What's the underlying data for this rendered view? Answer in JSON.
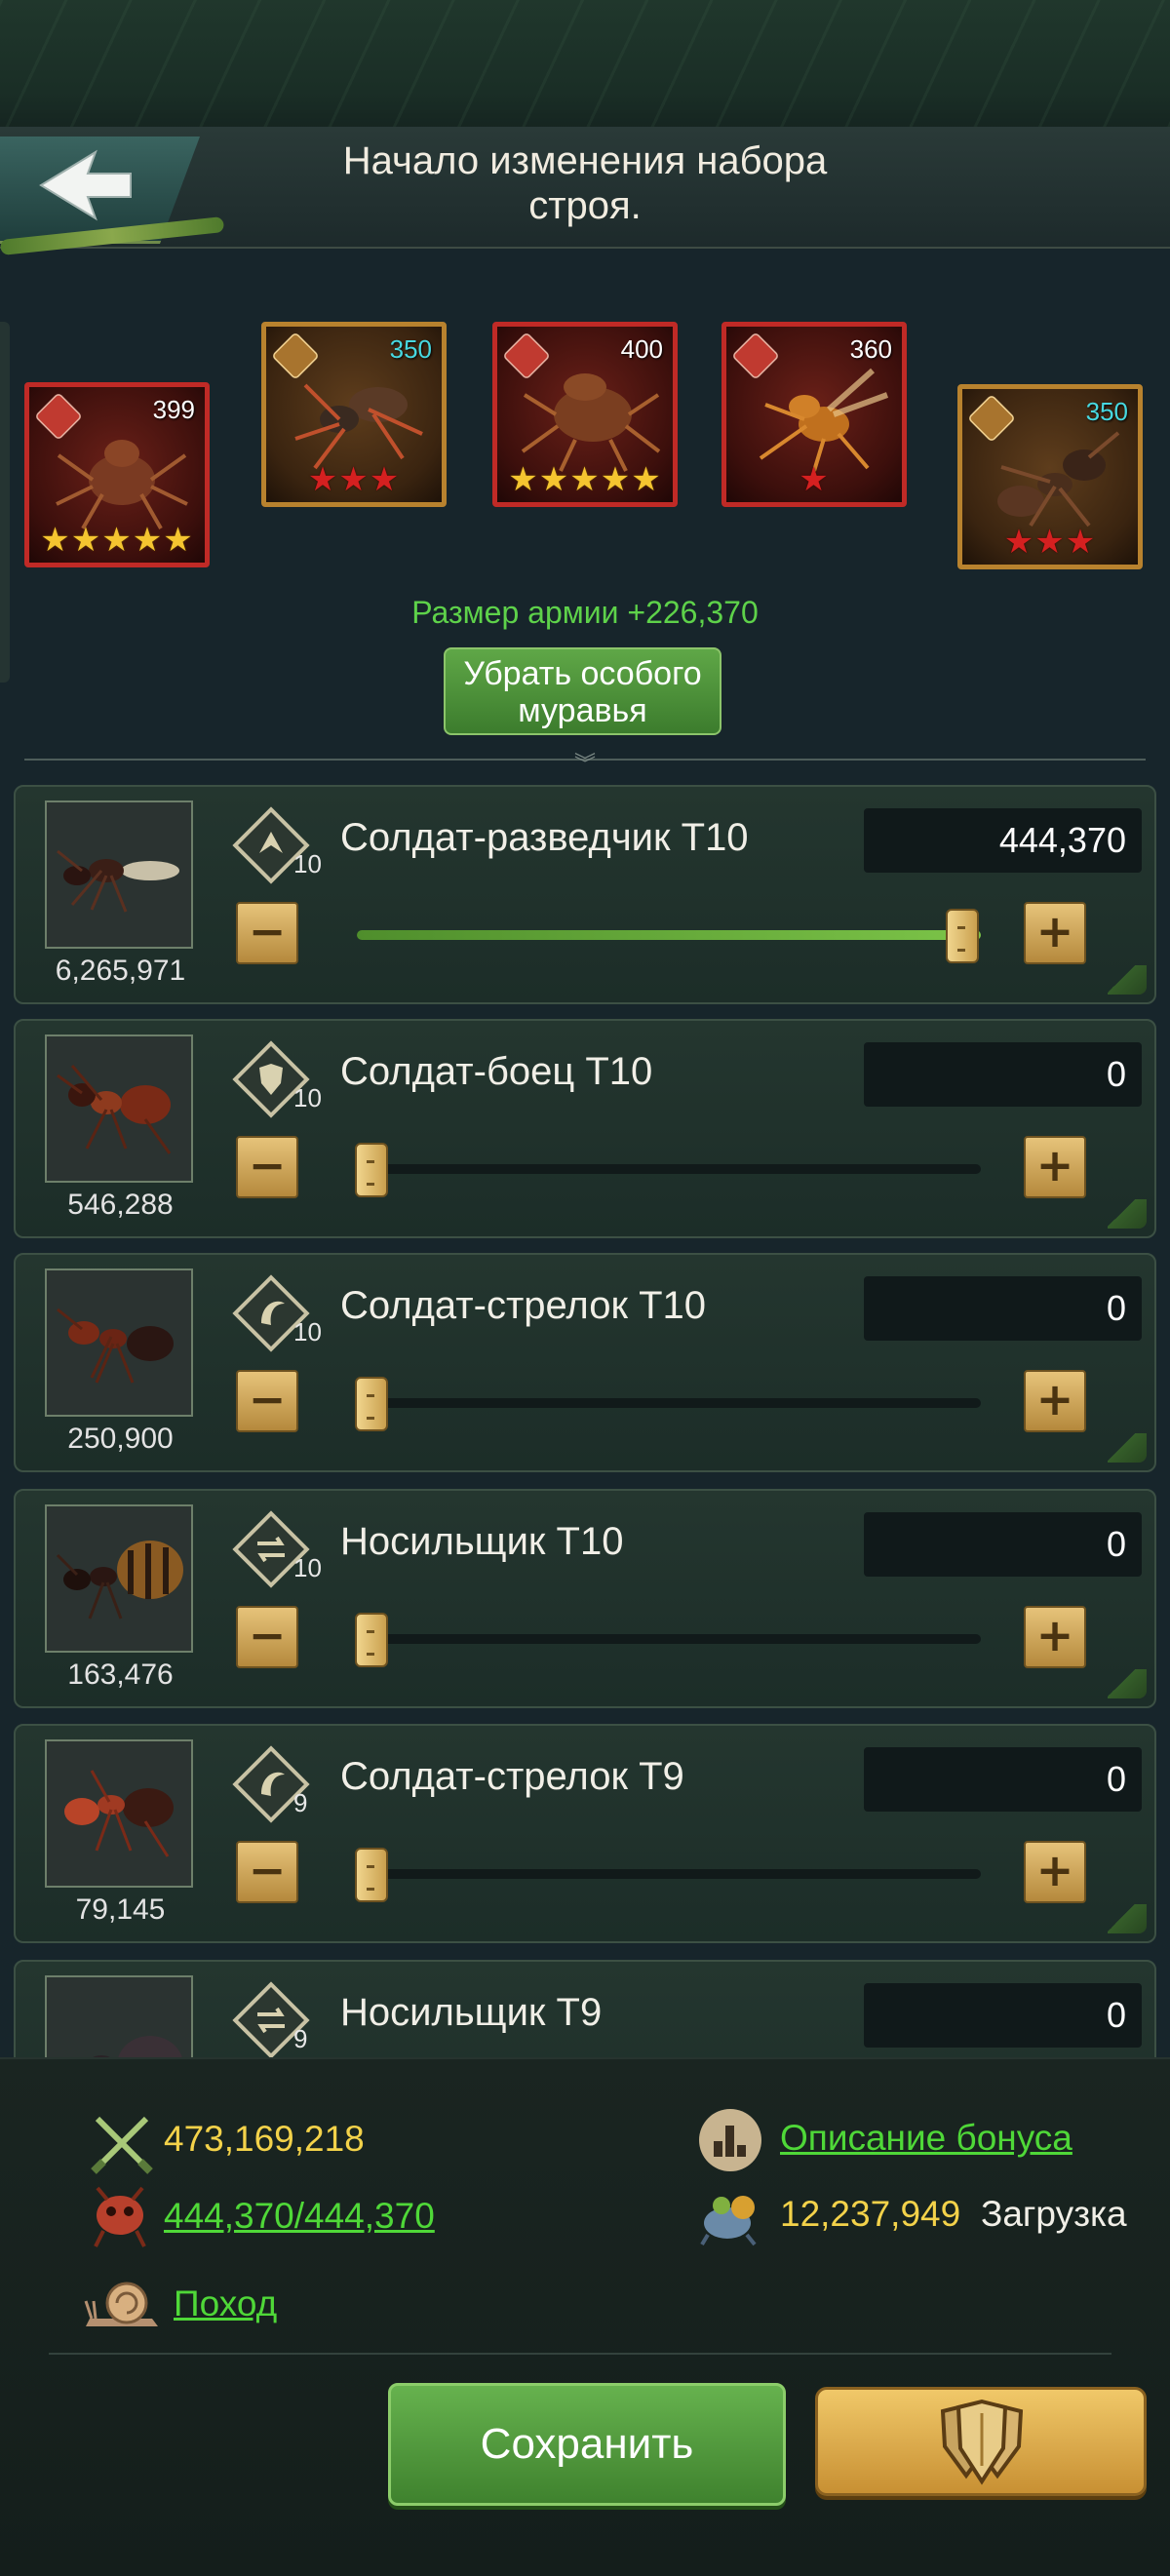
{
  "header": {
    "title_line1": "Начало изменения набора",
    "title_line2": "строя.",
    "back_icon": "back-arrow-icon"
  },
  "heroes": [
    {
      "level": "399",
      "stars": 5,
      "star_color": "yellow",
      "frame": "red",
      "type_icon": "boot-icon"
    },
    {
      "level": "350",
      "stars": 3,
      "star_color": "red",
      "frame": "gold",
      "type_icon": "boot-icon"
    },
    {
      "level": "400",
      "stars": 5,
      "star_color": "yellow",
      "frame": "red",
      "type_icon": "boot-icon"
    },
    {
      "level": "360",
      "stars": 1,
      "star_color": "red",
      "frame": "red",
      "type_icon": "swirl-icon"
    },
    {
      "level": "350",
      "stars": 3,
      "star_color": "red",
      "frame": "gold",
      "type_icon": "boot-icon"
    }
  ],
  "army_size": "Размер армии +226,370",
  "remove_special_button": {
    "line1": "Убрать особого",
    "line2": "муравья"
  },
  "troops": [
    {
      "name": "Солдат-разведчик T10",
      "tier": "10",
      "count": "6,265,971",
      "qty": "444,370",
      "fill": 1.0,
      "icon": "scout-icon"
    },
    {
      "name": "Солдат-боец T10",
      "tier": "10",
      "count": "546,288",
      "qty": "0",
      "fill": 0.0,
      "icon": "shield-icon"
    },
    {
      "name": "Солдат-стрелок T10",
      "tier": "10",
      "count": "250,900",
      "qty": "0",
      "fill": 0.0,
      "icon": "shooter-icon"
    },
    {
      "name": "Носильщик T10",
      "tier": "10",
      "count": "163,476",
      "qty": "0",
      "fill": 0.0,
      "icon": "carrier-icon"
    },
    {
      "name": "Солдат-стрелок T9",
      "tier": "9",
      "count": "79,145",
      "qty": "0",
      "fill": 0.0,
      "icon": "shooter-icon"
    },
    {
      "name": "Носильщик T9",
      "tier": "9",
      "count": "",
      "qty": "0",
      "fill": 0.0,
      "icon": "carrier-icon"
    }
  ],
  "bottom": {
    "power": "473,169,218",
    "troop_capacity": "444,370/444,370",
    "march_label": "Поход",
    "bonus_link": "Описание бонуса",
    "load_value": "12,237,949",
    "load_label": "Загрузка",
    "save_label": "Сохранить"
  },
  "colors": {
    "accent_green": "#5ed24a",
    "link_green": "#4fd838",
    "stat_yellow": "#f3d24a",
    "hero_red_frame": "#c02a26",
    "hero_gold_frame": "#b8822e",
    "level_cyan": "#47d8e0"
  }
}
